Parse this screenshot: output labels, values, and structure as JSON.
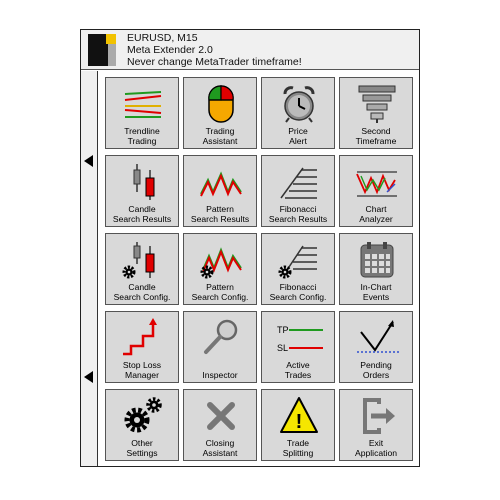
{
  "header": {
    "line1": "EURUSD, M15",
    "line2": "Meta Extender 2.0",
    "line3": "Never change MetaTrader timeframe!"
  },
  "tiles": [
    {
      "label": "Trendline\nTrading",
      "icon": "trendline-icon"
    },
    {
      "label": "Trading\nAssistant",
      "icon": "mouse-icon"
    },
    {
      "label": "Price\nAlert",
      "icon": "alarm-clock-icon"
    },
    {
      "label": "Second\nTimeframe",
      "icon": "funnel-stack-icon"
    },
    {
      "label": "Candle\nSearch Results",
      "icon": "candle-icon"
    },
    {
      "label": "Pattern\nSearch Results",
      "icon": "zigzag-pattern-icon"
    },
    {
      "label": "Fibonacci\nSearch Results",
      "icon": "fibonacci-icon"
    },
    {
      "label": "Chart\nAnalyzer",
      "icon": "chart-analyzer-icon"
    },
    {
      "label": "Candle\nSearch Config.",
      "icon": "candle-gear-icon"
    },
    {
      "label": "Pattern\nSearch Config.",
      "icon": "pattern-gear-icon"
    },
    {
      "label": "Fibonacci\nSearch Config.",
      "icon": "fibonacci-gear-icon"
    },
    {
      "label": "In-Chart\nEvents",
      "icon": "calendar-icon"
    },
    {
      "label": "Stop Loss\nManager",
      "icon": "stop-loss-icon"
    },
    {
      "label": "Inspector",
      "icon": "magnifier-icon"
    },
    {
      "label": "Active\nTrades",
      "icon": "tp-sl-icon",
      "tp": "TP",
      "sl": "SL"
    },
    {
      "label": "Pending\nOrders",
      "icon": "pending-order-icon"
    },
    {
      "label": "Other\nSettings",
      "icon": "gears-icon"
    },
    {
      "label": "Closing\nAssistant",
      "icon": "close-x-icon"
    },
    {
      "label": "Trade\nSplitting",
      "icon": "warning-icon",
      "mark": "!"
    },
    {
      "label": "Exit\nApplication",
      "icon": "exit-icon"
    }
  ],
  "colors": {
    "tile_bg": "#d9d9d9",
    "red": "#e00000",
    "green": "#1f9a1f",
    "yellow": "#f5e600"
  }
}
